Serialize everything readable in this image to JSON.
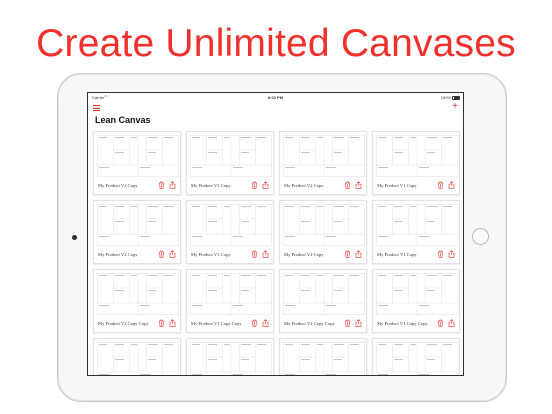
{
  "headline": "Create Unlimited Canvases",
  "status_bar": {
    "carrier": "Carrier",
    "time": "8:02 PM",
    "battery": "100%"
  },
  "nav": {
    "title": "Lean Canvas",
    "menu_icon": "hamburger-menu-icon",
    "add_icon": "plus-icon"
  },
  "canvases": [
    {
      "name": "My Product V2 Copy"
    },
    {
      "name": "My Product V1 Copy"
    },
    {
      "name": "My Product V2 Copy"
    },
    {
      "name": "My Product V1 Copy"
    },
    {
      "name": "My Product V2 Copy"
    },
    {
      "name": "My Product V1 Copy"
    },
    {
      "name": "My Product V2 Copy"
    },
    {
      "name": "My Product V1 Copy"
    },
    {
      "name": "My Product V2 Copy Copy"
    },
    {
      "name": "My Product V1 Copy Copy"
    },
    {
      "name": "My Product V2 Copy Copy"
    },
    {
      "name": "My Product V1 Copy Copy"
    },
    {
      "name": ""
    },
    {
      "name": ""
    },
    {
      "name": ""
    },
    {
      "name": ""
    }
  ],
  "colors": {
    "accent": "#f0302a",
    "frame": "#c9c9cd"
  }
}
